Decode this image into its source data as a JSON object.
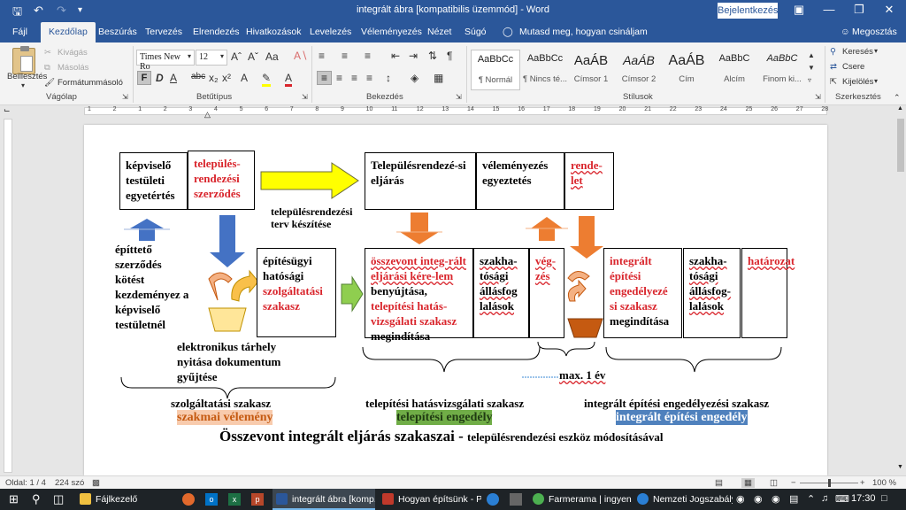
{
  "titlebar": {
    "title": "integrált ábra [kompatibilis üzemmód]  -  Word",
    "signin": "Bejelentkezés",
    "save_icon": "save-icon",
    "undo_icon": "undo-icon",
    "redo_icon": "redo-icon"
  },
  "tabs": [
    "Fájl",
    "Kezdőlap",
    "Beszúrás",
    "Tervezés",
    "Elrendezés",
    "Hivatkozások",
    "Levelezés",
    "Véleményezés",
    "Nézet",
    "Súgó"
  ],
  "tell_me": "Mutasd meg, hogyan csináljam",
  "share": "Megosztás",
  "clipboard": {
    "paste": "Beillesztés",
    "cut": "Kivágás",
    "copy": "Másolás",
    "format_painter": "Formátummásoló",
    "label": "Vágólap"
  },
  "font": {
    "name": "Times New Ro",
    "size": "12",
    "label": "Betűtípus",
    "bold": "F",
    "italic": "D",
    "underline": "A"
  },
  "paragraph": {
    "label": "Bekezdés"
  },
  "styles": {
    "label": "Stílusok",
    "items": [
      {
        "preview": "AaBbCc",
        "name": "¶ Normál"
      },
      {
        "preview": "AaBbCc",
        "name": "¶ Nincs té..."
      },
      {
        "preview": "AaÁB",
        "name": "Címsor 1"
      },
      {
        "preview": "AaÁB",
        "name": "Címsor 2"
      },
      {
        "preview": "AaÁB",
        "name": "Cím"
      },
      {
        "preview": "AaBbC",
        "name": "Alcím"
      },
      {
        "preview": "AaBbC",
        "name": "Finom ki..."
      }
    ]
  },
  "editing": {
    "label": "Szerkesztés",
    "find": "Keresés",
    "replace": "Csere",
    "select": "Kijelölés"
  },
  "ruler": [
    "1",
    "2",
    "1",
    "2",
    "3",
    "4",
    "5",
    "6",
    "7",
    "8",
    "9",
    "10",
    "11",
    "12",
    "13",
    "14",
    "15",
    "16",
    "17",
    "18",
    "19",
    "20",
    "21",
    "22",
    "23",
    "24",
    "25",
    "26",
    "27",
    "28"
  ],
  "document": {
    "box1": "képviselő testületi egyetértés",
    "box2": "település-rendezési szerződés",
    "caption_plan": "településrendezési terv készítése",
    "box_proc": "Településrendezé-si eljárás",
    "box_opinion": "véleményezés egyeztetés",
    "box_decree": "rende-let",
    "left_text": "építtető szerződés kötést kezdeményez a képviselő testületnél",
    "box_service_a": "építésügyi hatósági",
    "box_service_b": "szolgáltatási szakasz",
    "box_integrated_a": "összevont integ-rált eljárási kére-lem",
    "box_integrated_b": "benyújtása,",
    "box_integrated_c": "telepítési hatás-vizsgálati szakasz",
    "box_integrated_d": "megindítása",
    "box_expert1": "szakha-tósági állásfog lalások",
    "box_end": "vég-zés",
    "box_permit_a": "integrált építési engedélyezé si szakasz",
    "box_permit_b": "megindítása",
    "box_expert2": "szakha-tósági állásfog-lalások",
    "box_decision": "határozat",
    "storage_text": "elektronikus tárhely nyitása dokumentum gyűjtése",
    "max_year": "max. 1 év",
    "stage1": "szolgáltatási szakasz",
    "stage1_result": "szakmai vélemény",
    "stage2": "telepítési hatásvizsgálati szakasz",
    "stage2_result": "telepítési engedély",
    "stage3": "integrált építési engedélyezési szakasz",
    "stage3_result": "integrált építési engedély",
    "footer_big": "Összevont integrált eljárás szakaszai -",
    "footer_small": "településrendezési eszköz módosításával"
  },
  "colors": {
    "word_blue": "#2b579a",
    "highlight_orange": "#f8cbad",
    "highlight_green": "#70ad47",
    "highlight_blue": "#4f81bd",
    "red_text": "#d9262d",
    "arrow_yellow": "#ffff00",
    "arrow_blue": "#4472c4",
    "arrow_orange": "#f4b183",
    "arrow_green": "#8fce4f"
  },
  "status": {
    "page": "Oldal: 1 / 4",
    "words": "224 szó",
    "zoom": "100 %"
  },
  "taskbar": {
    "items": [
      "Fájlkezelő",
      "integrált ábra [komp...",
      "Hogyan építsünk - P...",
      "Farmerama | ingyen...",
      "Nemzeti Jogszabályt..."
    ],
    "time": "17:30"
  }
}
